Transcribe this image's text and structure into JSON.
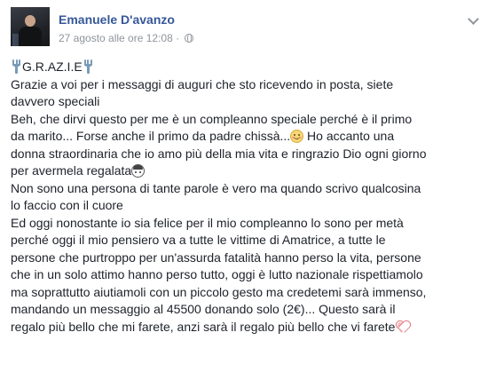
{
  "post": {
    "author": "Emanuele D'avanzo",
    "timestamp": "27 agosto alle ore 12:08",
    "separator": "·",
    "privacy_icon": "globe-icon",
    "menu_icon": "chevron-down-icon",
    "title_word": "G.R.AZ.I.E",
    "lines": [
      "Grazie a voi per i messaggi di auguri che sto ricevendo in posta, siete",
      "davvero speciali",
      "Beh, che dirvi questo per me è un compleanno speciale perché è il primo",
      "da marito... Forse anche il primo da padre chissà...",
      " Ho accanto una",
      "donna straordinaria che io amo più della mia vita e ringrazio Dio ogni giorno",
      "per avermela regalata",
      "Non sono una persona di tante parole è vero ma quando scrivo qualcosina",
      "lo faccio con il cuore",
      "Ed oggi nonostante io sia felice per il mio compleanno lo sono per metà",
      "perché oggi il mio pensiero va a tutte le vittime di Amatrice, a tutte le",
      "persone che purtroppo per un'assurda fatalità hanno perso la vita, persone",
      "che in un solo attimo hanno perso tutto, oggi è lutto nazionale rispettiamolo",
      "ma soprattutto aiutiamoli con un piccolo gesto ma credetemi sarà immenso,",
      "mandando un messaggio al 45500 donando solo (2€)... Questo sarà il",
      "regalo più bello che mi farete, anzi sarà il regalo più bello che vi farete"
    ],
    "emojis": {
      "title_left": "fork-icon",
      "title_right": "fork-icon",
      "after_chissa": "smiling-face-icon",
      "after_regalata": "face-icon",
      "end": "heart-icon"
    }
  },
  "colors": {
    "author_link": "#365899",
    "meta_text": "#90949c",
    "body_text": "#1d2129"
  }
}
